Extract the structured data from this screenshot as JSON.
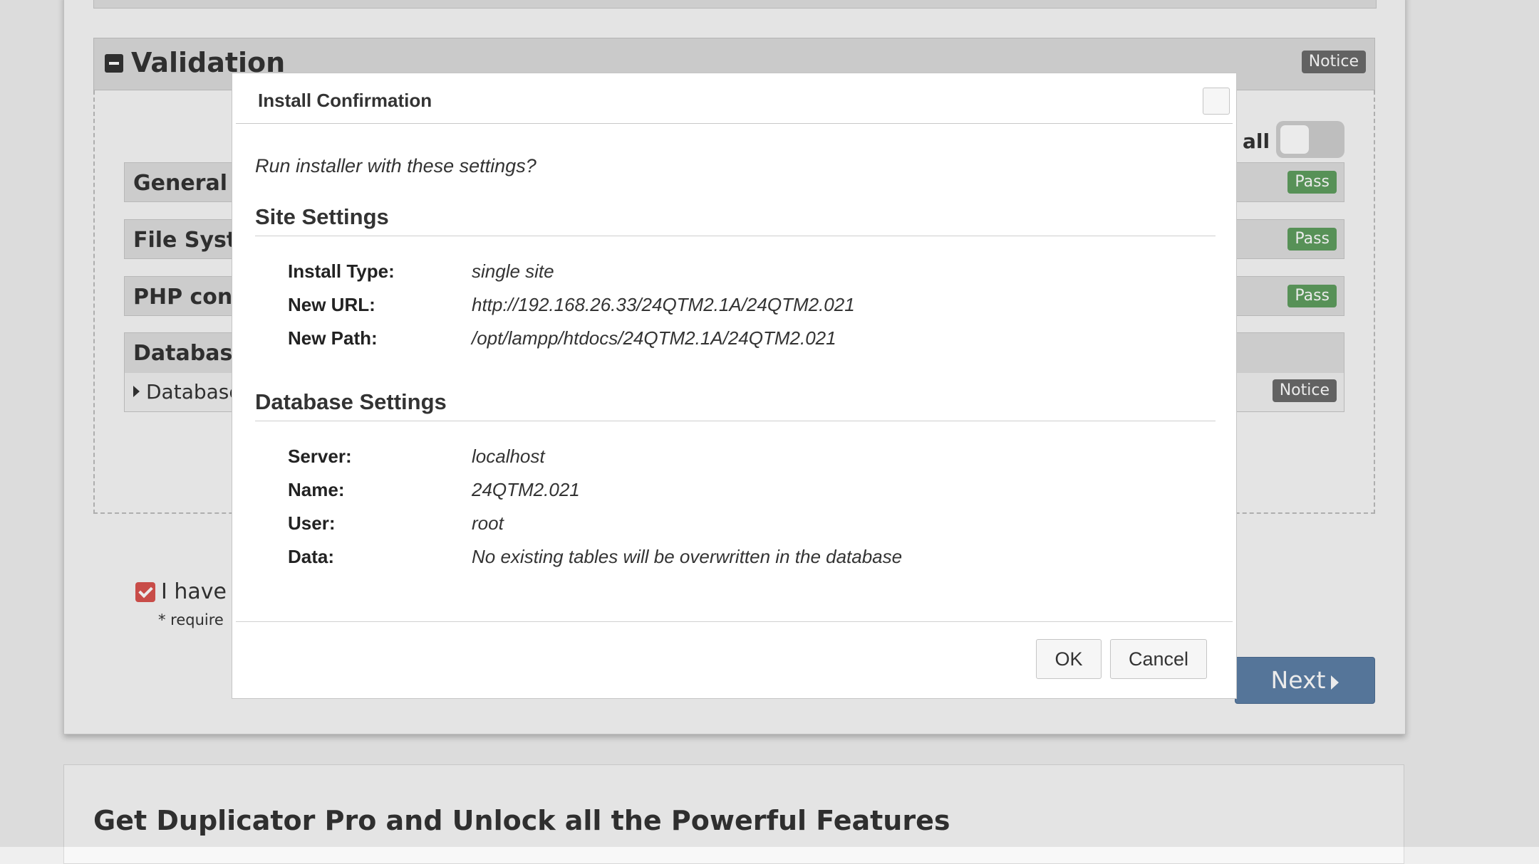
{
  "background": {
    "validation": {
      "title": "Validation",
      "badge": "Notice"
    },
    "show_all_label": "all",
    "checks": [
      {
        "title": "General",
        "badge": "Pass"
      },
      {
        "title": "File Syst",
        "badge": "Pass"
      },
      {
        "title": "PHP conf",
        "badge": "Pass"
      }
    ],
    "database": {
      "title": "Database",
      "sub_label": "Database",
      "badge": "Notice"
    },
    "accept_text": "I have",
    "required_note": "* require",
    "next_label": "Next",
    "promo_title": "Get Duplicator Pro and Unlock all the Powerful Features"
  },
  "dialog": {
    "title": "Install Confirmation",
    "question": "Run installer with these settings?",
    "site_settings": {
      "heading": "Site Settings",
      "rows": [
        {
          "label": "Install Type:",
          "value": "single site"
        },
        {
          "label": "New URL:",
          "value": "http://192.168.26.33/24QTM2.1A/24QTM2.021"
        },
        {
          "label": "New Path:",
          "value": "/opt/lampp/htdocs/24QTM2.1A/24QTM2.021"
        }
      ]
    },
    "database_settings": {
      "heading": "Database Settings",
      "rows": [
        {
          "label": "Server:",
          "value": "localhost"
        },
        {
          "label": "Name:",
          "value": "24QTM2.021"
        },
        {
          "label": "User:",
          "value": "root"
        },
        {
          "label": "Data:",
          "value": "No existing tables will be overwritten in the database"
        }
      ]
    },
    "ok_label": "OK",
    "cancel_label": "Cancel"
  },
  "colors": {
    "pass_badge": "#5f9e5f",
    "notice_badge": "#6b6b6b",
    "next_button": "#5d7fa6",
    "checkbox_checked": "#d9534f"
  }
}
